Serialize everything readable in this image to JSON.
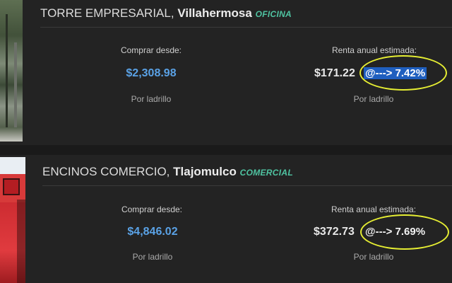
{
  "listings": [
    {
      "name": "TORRE EMPRESARIAL,",
      "city": "Villahermosa",
      "category": "OFICINA",
      "buy_label": "Comprar desde:",
      "buy_price": "$2,308.98",
      "buy_unit": "Por ladrillo",
      "rent_label": "Renta anual estimada:",
      "rent_value": "$171.22",
      "rate_text": "@---> 7.42%",
      "rent_unit": "Por ladrillo"
    },
    {
      "name": "ENCINOS COMERCIO,",
      "city": "Tlajomulco",
      "category": "COMERCIAL",
      "buy_label": "Comprar desde:",
      "buy_price": "$4,846.02",
      "buy_unit": "Por ladrillo",
      "rent_label": "Renta anual estimada:",
      "rent_value": "$372.73",
      "rate_text": "@---> 7.69%",
      "rent_unit": "Por ladrillo"
    }
  ],
  "colors": {
    "background": "#1f1f1f",
    "price_blue": "#5aa2e6",
    "category_green": "#4fc3a1",
    "highlight_blue": "#1f5fbf",
    "annotation_yellow": "#e6ee33"
  }
}
